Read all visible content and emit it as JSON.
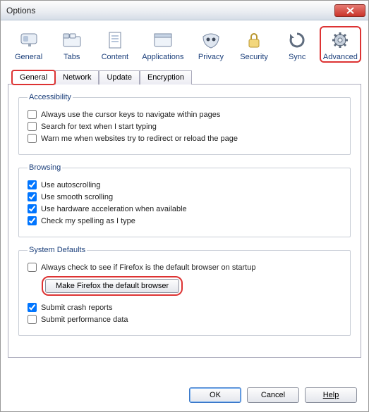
{
  "window": {
    "title": "Options"
  },
  "toolbar": {
    "items": [
      {
        "label": "General"
      },
      {
        "label": "Tabs"
      },
      {
        "label": "Content"
      },
      {
        "label": "Applications"
      },
      {
        "label": "Privacy"
      },
      {
        "label": "Security"
      },
      {
        "label": "Sync"
      },
      {
        "label": "Advanced"
      }
    ],
    "selected": "Advanced"
  },
  "tabs": {
    "items": [
      {
        "label": "General"
      },
      {
        "label": "Network"
      },
      {
        "label": "Update"
      },
      {
        "label": "Encryption"
      }
    ],
    "active": "General"
  },
  "sections": {
    "accessibility": {
      "legend": "Accessibility",
      "opts": [
        {
          "label": "Always use the cursor keys to navigate within pages",
          "checked": false
        },
        {
          "label": "Search for text when I start typing",
          "checked": false
        },
        {
          "label": "Warn me when websites try to redirect or reload the page",
          "checked": false
        }
      ]
    },
    "browsing": {
      "legend": "Browsing",
      "opts": [
        {
          "label": "Use autoscrolling",
          "checked": true
        },
        {
          "label": "Use smooth scrolling",
          "checked": true
        },
        {
          "label": "Use hardware acceleration when available",
          "checked": true
        },
        {
          "label": "Check my spelling as I type",
          "checked": true
        }
      ]
    },
    "systemdefaults": {
      "legend": "System Defaults",
      "checkDefault": {
        "label": "Always check to see if Firefox is the default browser on startup",
        "checked": false
      },
      "makeDefaultBtn": "Make Firefox the default browser",
      "submitCrash": {
        "label": "Submit crash reports",
        "checked": true
      },
      "submitPerf": {
        "label": "Submit performance data",
        "checked": false
      }
    }
  },
  "buttons": {
    "ok": "OK",
    "cancel": "Cancel",
    "help": "Help"
  }
}
